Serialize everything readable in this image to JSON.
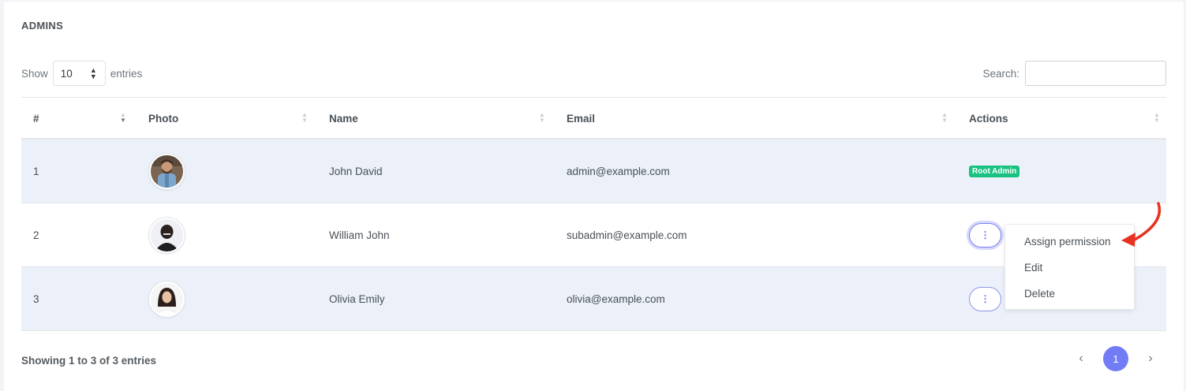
{
  "card": {
    "title": "ADMINS"
  },
  "length": {
    "show_label": "Show",
    "value": "10",
    "entries_label": "entries"
  },
  "search": {
    "label": "Search:",
    "value": ""
  },
  "table": {
    "headers": [
      "#",
      "Photo",
      "Name",
      "Email",
      "Actions"
    ],
    "rows": [
      {
        "index": "1",
        "name": "John David",
        "email": "admin@example.com",
        "action_badge": "Root Admin",
        "avatar": "man-with-beard-avatar"
      },
      {
        "index": "2",
        "name": "William John",
        "email": "subadmin@example.com",
        "action_icon": "⋮",
        "avatar": "man-dark-avatar"
      },
      {
        "index": "3",
        "name": "Olivia Emily",
        "email": "olivia@example.com",
        "action_icon": "⋮",
        "avatar": "woman-avatar"
      }
    ]
  },
  "dropdown": {
    "items": [
      "Assign permission",
      "Edit",
      "Delete"
    ]
  },
  "footer": {
    "info": "Showing 1 to 3 of 3 entries"
  },
  "pagination": {
    "prev": "‹",
    "current": "1",
    "next": "›"
  },
  "colors": {
    "accent": "#727cf5",
    "badge": "#1ac281",
    "annotation_arrow": "#e8321f",
    "stripe": "#ecf0f9"
  }
}
